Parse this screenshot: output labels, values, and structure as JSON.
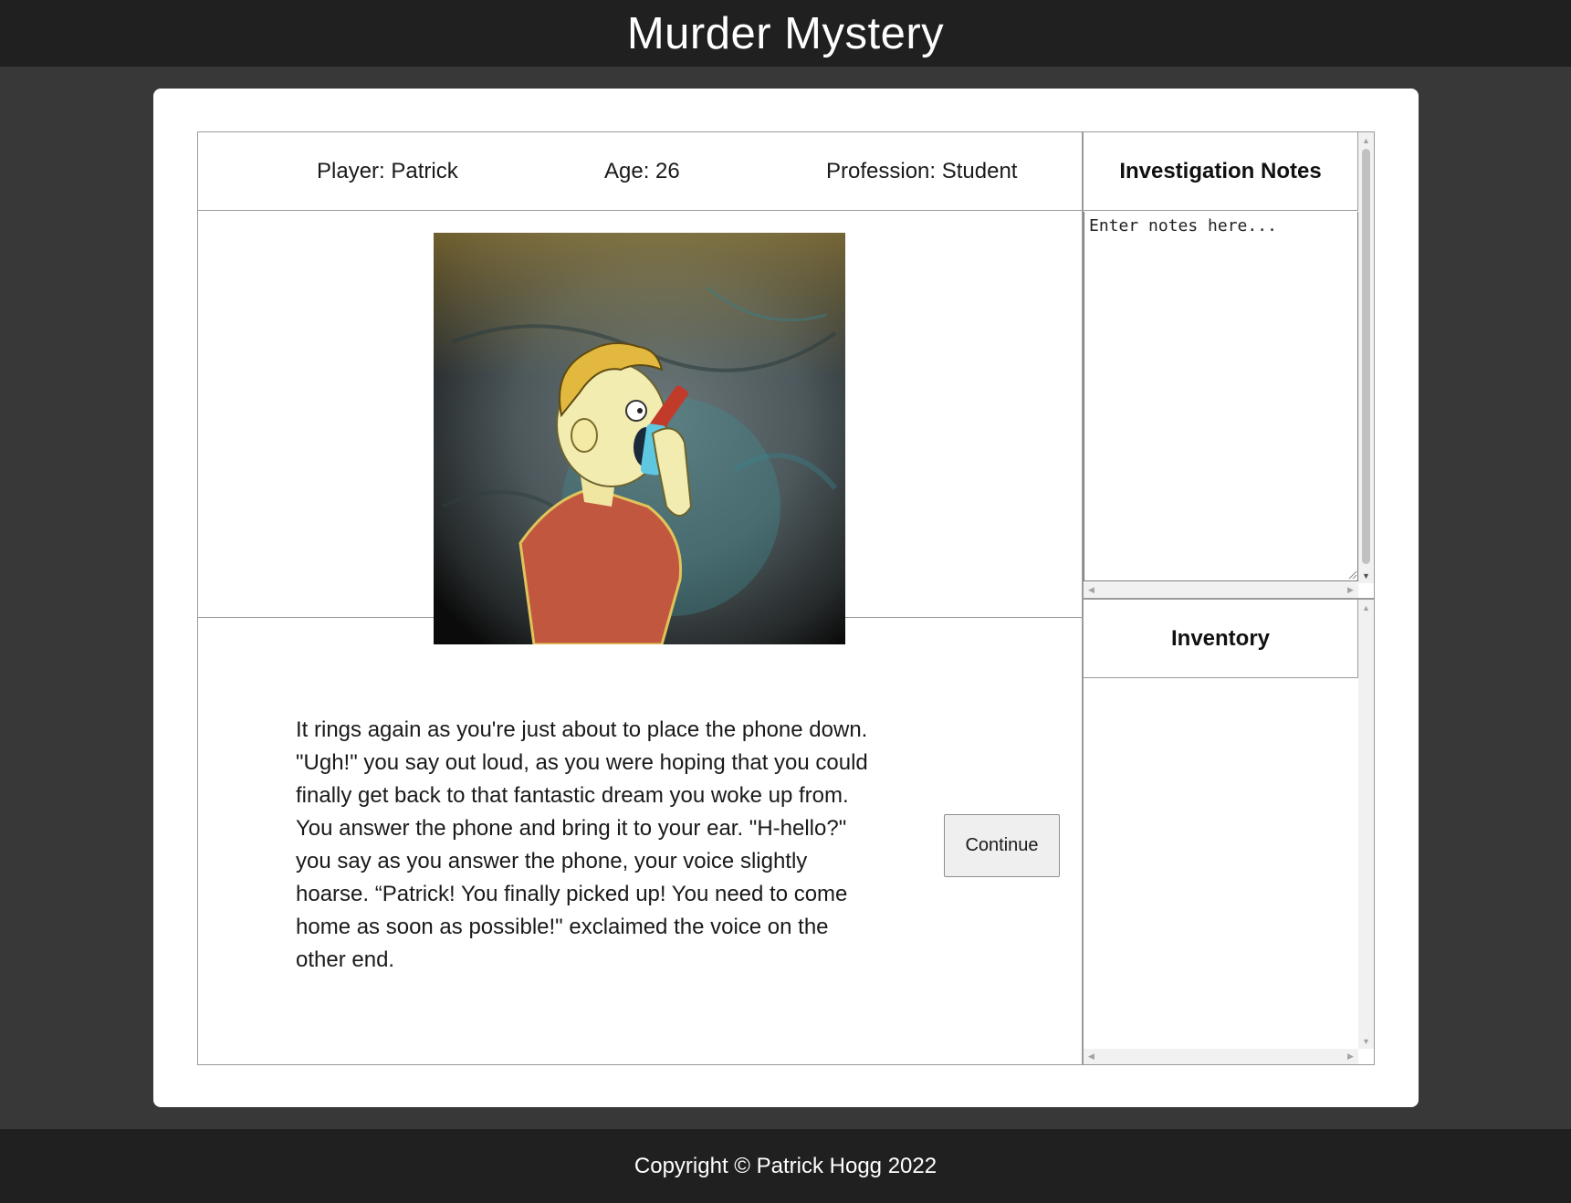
{
  "header": {
    "title": "Murder Mystery"
  },
  "player": {
    "name_label": "Player: Patrick",
    "age_label": "Age: 26",
    "profession_label": "Profession: Student"
  },
  "story": {
    "text": "It rings again as you're just about to place the phone down. \"Ugh!\" you say out loud, as you were hoping that you could finally get back to that fantastic dream you woke up from. You answer the phone and bring it to your ear. \"H-hello?\" you say as you answer the phone, your voice slightly hoarse. “Patrick! You finally picked up! You need to come home as soon as possible!\" exclaimed the voice on the other end.",
    "continue_label": "Continue"
  },
  "notes": {
    "heading": "Investigation Notes",
    "placeholder": "Enter notes here..."
  },
  "inventory": {
    "heading": "Inventory",
    "items": []
  },
  "footer": {
    "copyright": "Copyright © Patrick Hogg 2022"
  }
}
